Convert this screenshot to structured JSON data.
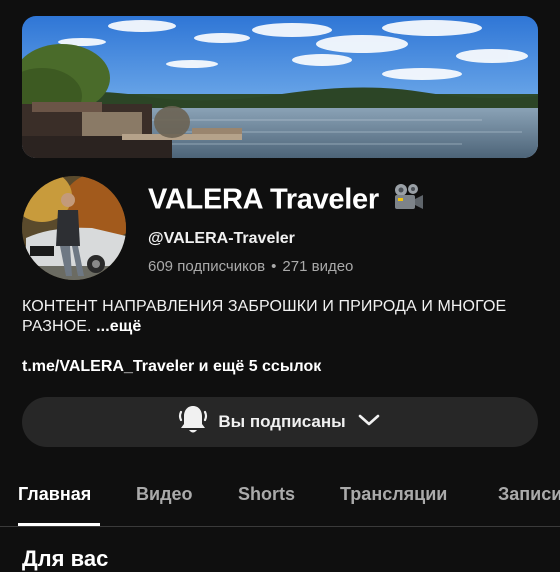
{
  "channel": {
    "name": "VALERA Traveler",
    "handle": "@VALERA-Traveler",
    "subscribers": "609 подписчиков",
    "separator": "•",
    "videos": "271 видео",
    "description": "КОНТЕНТ НАПРАВЛЕНИЯ ЗАБРОШКИ И ПРИРОДА И МНОГОЕ РАЗНОЕ.",
    "more_label": "...ещё",
    "links_text": "t.me/VALERA_Traveler и ещё 5 ссылок"
  },
  "subscribe_button": {
    "label": "Вы подписаны",
    "icons": [
      "bell-icon",
      "chevron-down-icon"
    ]
  },
  "tabs": [
    {
      "label": "Главная",
      "active": true
    },
    {
      "label": "Видео",
      "active": false
    },
    {
      "label": "Shorts",
      "active": false
    },
    {
      "label": "Трансляции",
      "active": false
    },
    {
      "label": "Записи",
      "active": false
    }
  ],
  "section": {
    "heading": "Для вас"
  },
  "colors": {
    "background": "#0f0f0f",
    "button_bg": "#272727",
    "text_primary": "#ffffff",
    "text_secondary": "#aaaaaa"
  }
}
